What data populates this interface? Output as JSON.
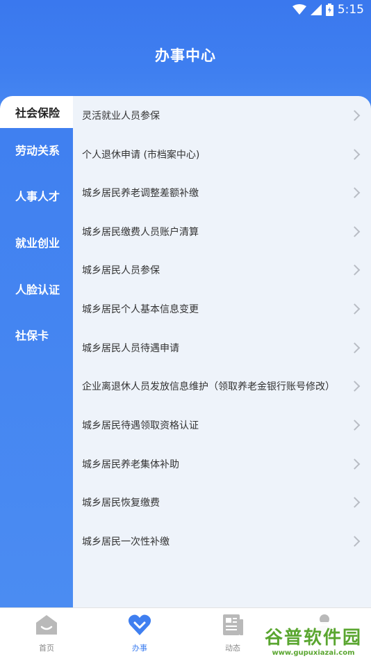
{
  "status": {
    "time": "5:15"
  },
  "header": {
    "title": "办事中心"
  },
  "sidebar": {
    "items": [
      {
        "label": "社会保险",
        "active": true
      },
      {
        "label": "劳动关系"
      },
      {
        "label": "人事人才"
      },
      {
        "label": "就业创业"
      },
      {
        "label": "人脸认证"
      },
      {
        "label": "社保卡"
      }
    ]
  },
  "list": {
    "items": [
      "灵活就业人员参保",
      "个人退休申请 (市档案中心)",
      "城乡居民养老调整差额补缴",
      "城乡居民缴费人员账户清算",
      "城乡居民人员参保",
      "城乡居民个人基本信息变更",
      "城乡居民人员待遇申请",
      "企业离退休人员发放信息维护（领取养老金银行账号修改）",
      "城乡居民待遇领取资格认证",
      "城乡居民养老集体补助",
      "城乡居民恢复缴费",
      "城乡居民一次性补缴"
    ]
  },
  "tabbar": {
    "tabs": [
      {
        "label": "首页",
        "icon": "home-icon"
      },
      {
        "label": "办事",
        "icon": "heart-icon",
        "active": true
      },
      {
        "label": "动态",
        "icon": "news-icon"
      },
      {
        "label": "",
        "icon": "user-icon"
      }
    ]
  },
  "watermark": {
    "main": "谷普软件园",
    "url": "www.gupuxiazai.com"
  },
  "colors": {
    "primary": "#3f7ff0",
    "list_bg": "#eef3fa",
    "watermark": "#5aa630"
  }
}
